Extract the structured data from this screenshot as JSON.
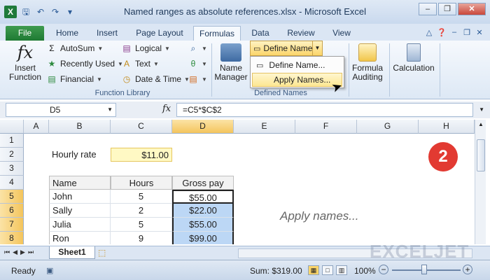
{
  "window": {
    "title": "Named ranges as absolute references.xlsx - Microsoft Excel",
    "app_icon_letter": "X"
  },
  "tabs": [
    {
      "label": "File"
    },
    {
      "label": "Home"
    },
    {
      "label": "Insert"
    },
    {
      "label": "Page Layout"
    },
    {
      "label": "Formulas",
      "active": true
    },
    {
      "label": "Data"
    },
    {
      "label": "Review"
    },
    {
      "label": "View"
    }
  ],
  "ribbon": {
    "function_library": {
      "insert_function": "Insert Function",
      "autosum": "AutoSum",
      "recently_used": "Recently Used",
      "financial": "Financial",
      "logical": "Logical",
      "text": "Text",
      "date_time": "Date & Time",
      "group_label": "Function Library"
    },
    "defined_names": {
      "name_manager": "Name Manager",
      "define_name": "Define Name",
      "group_label": "Defined Names"
    },
    "formula_auditing": "Formula Auditing",
    "calculation": "Calculation"
  },
  "dropdown": {
    "items": [
      {
        "label": "Define Name..."
      },
      {
        "label": "Apply Names..."
      }
    ]
  },
  "formula_bar": {
    "name_box": "D5",
    "fx": "fx",
    "formula": "=C5*$C$2"
  },
  "grid": {
    "columns": [
      "A",
      "B",
      "C",
      "D",
      "E",
      "F",
      "G",
      "H"
    ],
    "selected_column": "D",
    "rows": [
      "1",
      "2",
      "3",
      "4",
      "5",
      "6",
      "7",
      "8"
    ],
    "selected_rows": [
      "5",
      "6",
      "7",
      "8"
    ],
    "cells": {
      "hourly_rate_label": "Hourly rate",
      "hourly_rate_value": "$11.00",
      "hdr_name": "Name",
      "hdr_hours": "Hours",
      "hdr_gross": "Gross pay",
      "data": [
        {
          "name": "John",
          "hours": "5",
          "gross": "$55.00"
        },
        {
          "name": "Sally",
          "hours": "2",
          "gross": "$22.00"
        },
        {
          "name": "Julia",
          "hours": "5",
          "gross": "$55.00"
        },
        {
          "name": "Ron",
          "hours": "9",
          "gross": "$99.00"
        }
      ]
    },
    "badge": "2",
    "annotation": "Apply names..."
  },
  "sheets": {
    "active": "Sheet1"
  },
  "watermark": "EXCELJET",
  "status": {
    "ready": "Ready",
    "sum": "Sum: $319.00",
    "zoom": "100%"
  },
  "colors": {
    "hourly_rate_fill": "#fff9c4",
    "selection_fill": "#bcd7f5",
    "badge": "#e23a32",
    "file_tab": "#1e7a33"
  }
}
